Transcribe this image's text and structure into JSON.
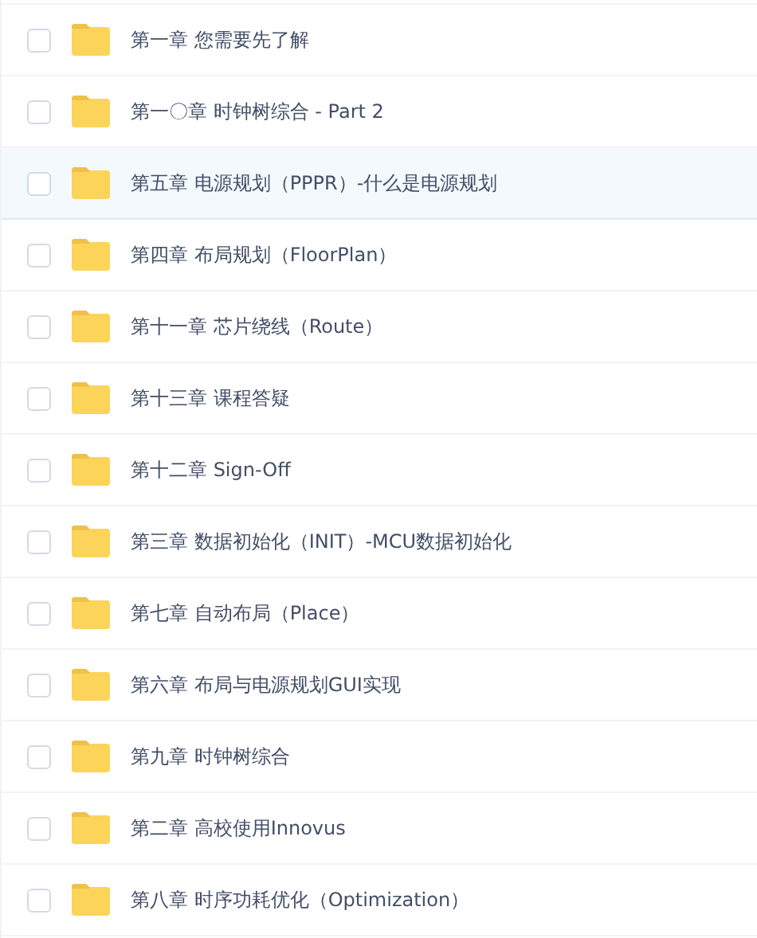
{
  "files": [
    {
      "name": "第一章 您需要先了解",
      "checked": false,
      "highlighted": false
    },
    {
      "name": "第一〇章 时钟树综合 - Part 2",
      "checked": false,
      "highlighted": false
    },
    {
      "name": "第五章 电源规划（PPPR）-什么是电源规划",
      "checked": false,
      "highlighted": true
    },
    {
      "name": "第四章 布局规划（FloorPlan）",
      "checked": false,
      "highlighted": false
    },
    {
      "name": "第十一章 芯片绕线（Route）",
      "checked": false,
      "highlighted": false
    },
    {
      "name": "第十三章 课程答疑",
      "checked": false,
      "highlighted": false
    },
    {
      "name": "第十二章 Sign-Off",
      "checked": false,
      "highlighted": false
    },
    {
      "name": "第三章 数据初始化（INIT）-MCU数据初始化",
      "checked": false,
      "highlighted": false
    },
    {
      "name": "第七章 自动布局（Place）",
      "checked": false,
      "highlighted": false
    },
    {
      "name": "第六章 布局与电源规划GUI实现",
      "checked": false,
      "highlighted": false
    },
    {
      "name": "第九章 时钟树综合",
      "checked": false,
      "highlighted": false
    },
    {
      "name": "第二章 高校使用Innovus",
      "checked": false,
      "highlighted": false
    },
    {
      "name": "第八章 时序功耗优化（Optimization）",
      "checked": false,
      "highlighted": false
    }
  ]
}
